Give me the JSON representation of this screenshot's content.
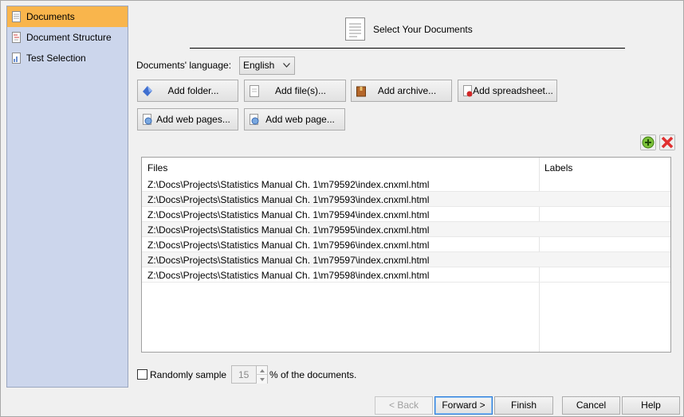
{
  "sidebar": {
    "items": [
      {
        "label": "Documents",
        "icon": "document-icon",
        "selected": true
      },
      {
        "label": "Document Structure",
        "icon": "structure-icon",
        "selected": false
      },
      {
        "label": "Test Selection",
        "icon": "chart-icon",
        "selected": false
      }
    ]
  },
  "header": {
    "title": "Select Your Documents",
    "icon": "document-icon"
  },
  "language": {
    "label": "Documents' language:",
    "value": "English"
  },
  "add_buttons": {
    "folder": "Add folder...",
    "files": "Add file(s)...",
    "archive": "Add archive...",
    "spreadsheet": "Add spreadsheet...",
    "web_pages": "Add web pages...",
    "web_page": "Add web page..."
  },
  "table": {
    "columns": [
      "Files",
      "Labels"
    ],
    "rows": [
      {
        "file": "Z:\\Docs\\Projects\\Statistics Manual Ch. 1\\m79592\\index.cnxml.html",
        "label": ""
      },
      {
        "file": "Z:\\Docs\\Projects\\Statistics Manual Ch. 1\\m79593\\index.cnxml.html",
        "label": ""
      },
      {
        "file": "Z:\\Docs\\Projects\\Statistics Manual Ch. 1\\m79594\\index.cnxml.html",
        "label": ""
      },
      {
        "file": "Z:\\Docs\\Projects\\Statistics Manual Ch. 1\\m79595\\index.cnxml.html",
        "label": ""
      },
      {
        "file": "Z:\\Docs\\Projects\\Statistics Manual Ch. 1\\m79596\\index.cnxml.html",
        "label": ""
      },
      {
        "file": "Z:\\Docs\\Projects\\Statistics Manual Ch. 1\\m79597\\index.cnxml.html",
        "label": ""
      },
      {
        "file": "Z:\\Docs\\Projects\\Statistics Manual Ch. 1\\m79598\\index.cnxml.html",
        "label": ""
      }
    ]
  },
  "sample": {
    "label": "Randomly sample",
    "value": "15",
    "suffix": "% of the documents.",
    "checked": false
  },
  "nav": {
    "back": "< Back",
    "forward": "Forward >",
    "finish": "Finish",
    "cancel": "Cancel",
    "help": "Help"
  },
  "colors": {
    "selected": "#f9b54c",
    "sidebar": "#ccd6ec",
    "add": "#7cc23a",
    "remove": "#e03030"
  }
}
